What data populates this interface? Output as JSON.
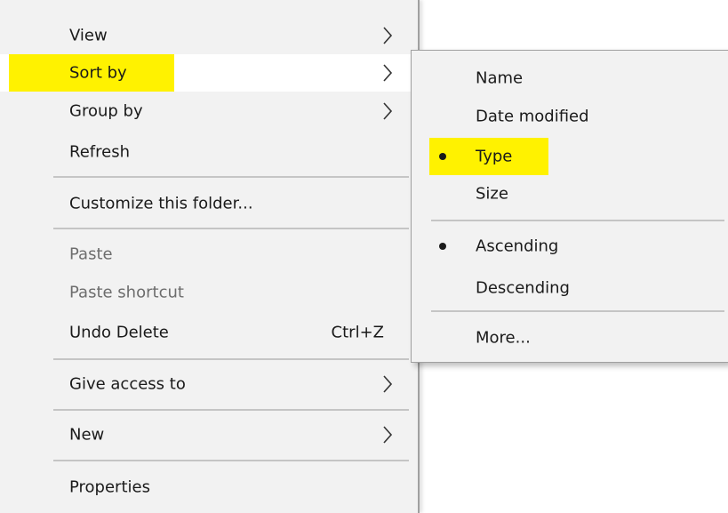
{
  "main_menu": {
    "items": [
      {
        "label": "View",
        "has_submenu": true
      },
      {
        "label": "Sort by",
        "has_submenu": true,
        "highlighted": true
      },
      {
        "label": "Group by",
        "has_submenu": true
      },
      {
        "label": "Refresh"
      },
      {
        "label": "Customize this folder..."
      },
      {
        "label": "Paste",
        "disabled": true
      },
      {
        "label": "Paste shortcut",
        "disabled": true
      },
      {
        "label": "Undo Delete",
        "shortcut": "Ctrl+Z"
      },
      {
        "label": "Give access to",
        "has_submenu": true
      },
      {
        "label": "New",
        "has_submenu": true
      },
      {
        "label": "Properties"
      }
    ]
  },
  "sort_submenu": {
    "items": [
      {
        "label": "Name"
      },
      {
        "label": "Date modified"
      },
      {
        "label": "Type",
        "selected": true,
        "highlighted": true
      },
      {
        "label": "Size"
      },
      {
        "label": "Ascending",
        "selected": true
      },
      {
        "label": "Descending"
      },
      {
        "label": "More..."
      }
    ]
  },
  "colors": {
    "highlight": "#fff200",
    "menu_background": "#f2f2f2",
    "disabled_text": "#6d6d6d"
  }
}
